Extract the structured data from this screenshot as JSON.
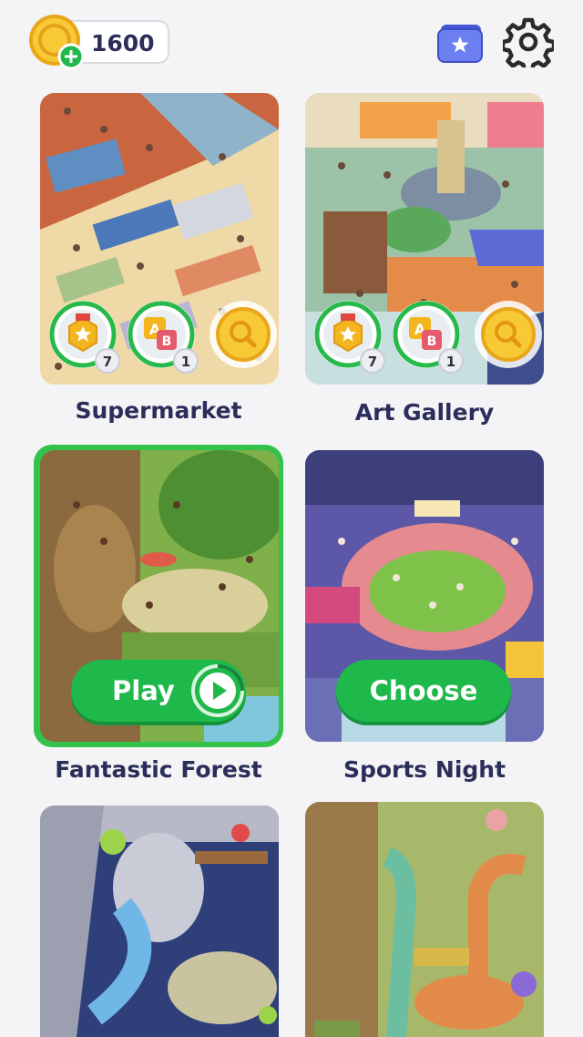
{
  "header": {
    "coins": "1600",
    "add_coins_icon": "plus-icon",
    "collection_icon": "star-wallet-icon",
    "settings_icon": "gear-icon"
  },
  "levels": [
    {
      "name": "Supermarket",
      "badges": {
        "medal_count": "7",
        "ab_count": "1"
      }
    },
    {
      "name": "Art Gallery",
      "badges": {
        "medal_count": "7",
        "ab_count": "1"
      }
    },
    {
      "name": "Fantastic Forest",
      "action": "Play",
      "selected": true
    },
    {
      "name": "Sports Night",
      "action": "Choose"
    },
    {
      "name": "",
      "art": "dragon-cave"
    },
    {
      "name": "",
      "art": "dinosaur-jungle"
    }
  ],
  "colors": {
    "accent_green": "#1fb84a",
    "title_navy": "#2b2d5a",
    "background": "#f4f4f6"
  }
}
